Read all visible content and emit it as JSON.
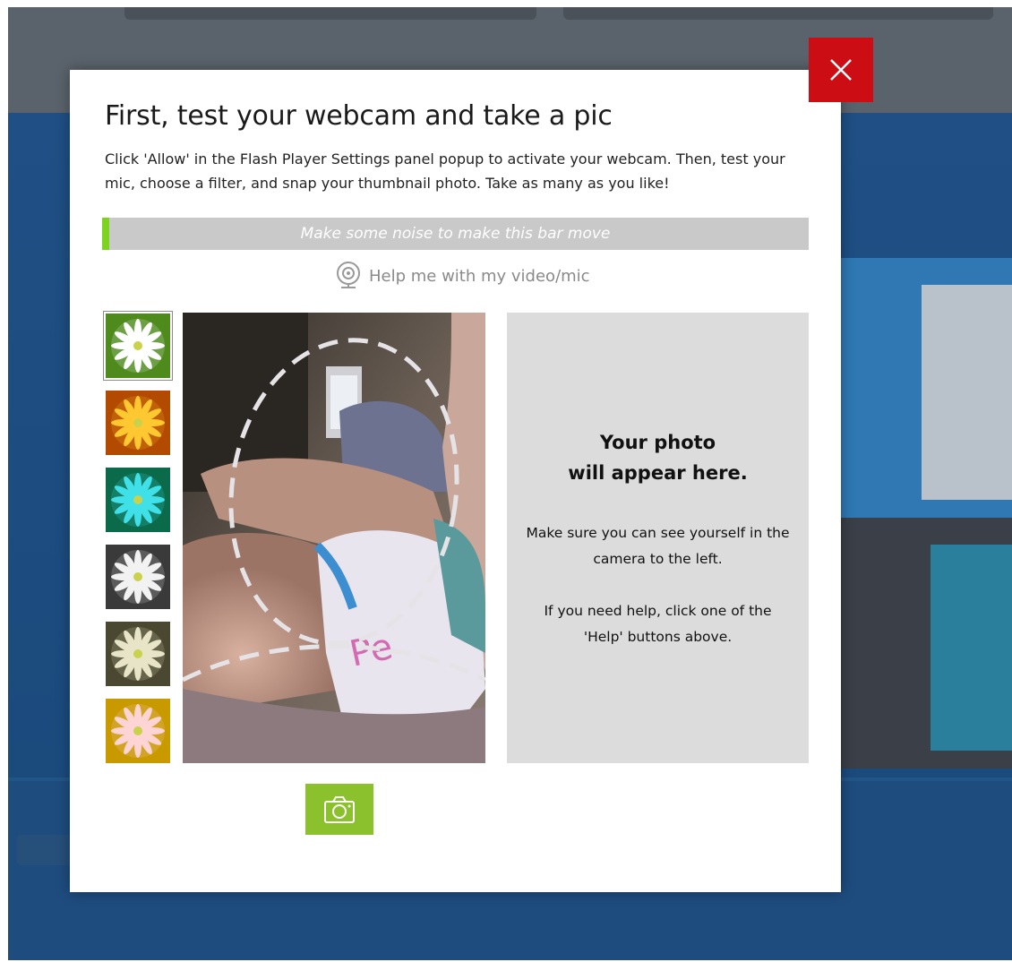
{
  "modal": {
    "title": "First, test your webcam and take a pic",
    "description": "Click 'Allow' in the Flash Player Settings panel popup to activate your webcam. Then, test your mic, choose a filter, and snap your thumbnail photo. Take as many  as you like!",
    "mic_bar": {
      "label": "Make some noise to make this bar move",
      "level_percent": 1
    },
    "help_link": {
      "label": "Help me with my video/mic",
      "icon": "webcam-icon"
    },
    "filters": [
      {
        "name": "original",
        "selected": true,
        "bg": "#4e8a1c",
        "petal": "#ffffff"
      },
      {
        "name": "warm",
        "selected": false,
        "bg": "#b24a00",
        "petal": "#ffc830"
      },
      {
        "name": "cool",
        "selected": false,
        "bg": "#0b6a4a",
        "petal": "#40e0e8"
      },
      {
        "name": "grayscale",
        "selected": false,
        "bg": "#3a3a3a",
        "petal": "#f2f2f2"
      },
      {
        "name": "vintage",
        "selected": false,
        "bg": "#4a4830",
        "petal": "#e8e4c8"
      },
      {
        "name": "vivid",
        "selected": false,
        "bg": "#c89a00",
        "petal": "#ffd4d4"
      }
    ],
    "photo_panel": {
      "title": "Your photo\nwill appear here.",
      "note": "Make sure you can see yourself in the camera to the left.\n\nIf you need help, click one of the 'Help' buttons above."
    },
    "snap_button": {
      "icon": "camera-icon"
    },
    "close_button": {
      "icon": "close-icon"
    }
  },
  "colors": {
    "close": "#cc0d14",
    "snap": "#8bc12c",
    "mic_level": "#7ed321",
    "mic_track": "#c9c9c9",
    "photo_panel": "#dcdcdc"
  }
}
